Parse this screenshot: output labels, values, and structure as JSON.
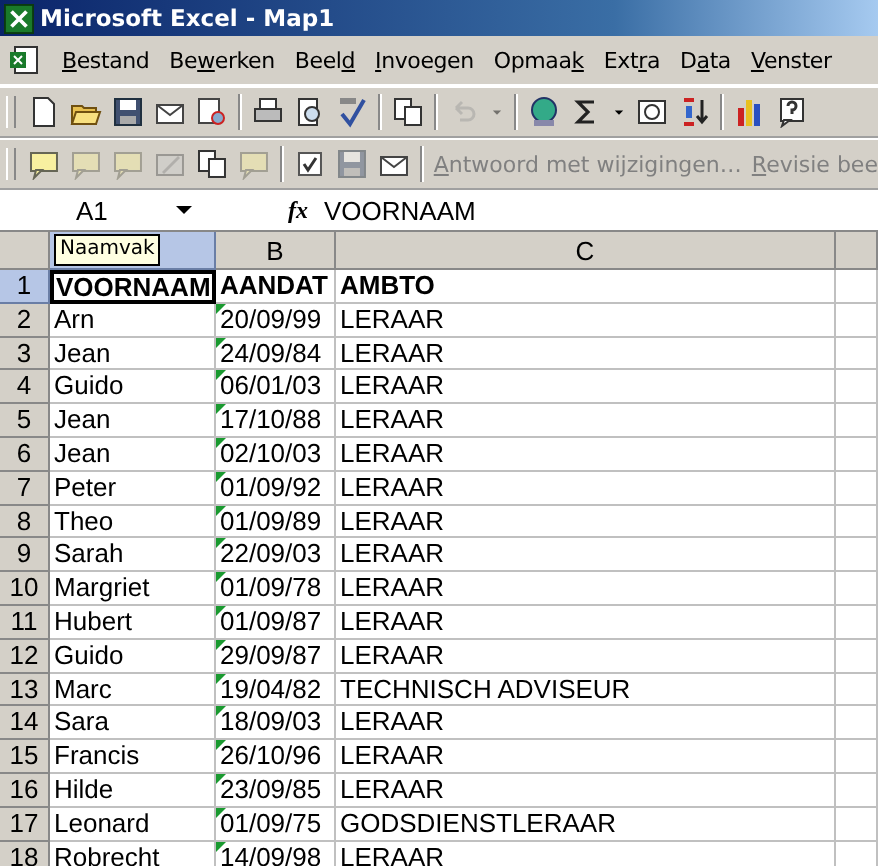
{
  "window": {
    "title": "Microsoft Excel - Map1"
  },
  "menu": [
    {
      "key": "B",
      "post": "estand"
    },
    {
      "pre": "Be",
      "key": "w",
      "post": "erken"
    },
    {
      "pre": "Beel",
      "key": "d"
    },
    {
      "key": "I",
      "post": "nvoegen"
    },
    {
      "pre": "Opmaa",
      "key": "k"
    },
    {
      "pre": "Ext",
      "key": "r",
      "post": "a"
    },
    {
      "pre": "D",
      "key": "a",
      "post": "ta"
    },
    {
      "key": "V",
      "post": "enster"
    }
  ],
  "toolbars": [
    {
      "items": [
        {
          "kind": "new",
          "disabled": false
        },
        {
          "kind": "open",
          "disabled": false
        },
        {
          "kind": "save",
          "disabled": false
        },
        {
          "kind": "mail",
          "disabled": false
        },
        {
          "kind": "web",
          "disabled": false
        },
        {
          "kind": "separator",
          "disabled": false
        },
        {
          "kind": "print",
          "disabled": false
        },
        {
          "kind": "preview",
          "disabled": false
        },
        {
          "kind": "spelling",
          "disabled": false
        },
        {
          "kind": "separator",
          "disabled": false
        },
        {
          "kind": "copy",
          "disabled": false
        },
        {
          "kind": "separator",
          "disabled": false
        },
        {
          "kind": "undo",
          "disabled": true
        },
        {
          "kind": "dropdown",
          "disabled": true
        },
        {
          "kind": "separator",
          "disabled": false
        },
        {
          "kind": "globe",
          "disabled": false
        },
        {
          "kind": "sum",
          "disabled": false
        },
        {
          "kind": "dropdown",
          "disabled": false
        },
        {
          "kind": "currency",
          "disabled": false
        },
        {
          "kind": "sort",
          "disabled": false
        },
        {
          "kind": "separator",
          "disabled": false
        },
        {
          "kind": "chart",
          "disabled": false
        },
        {
          "kind": "help",
          "disabled": false
        }
      ]
    },
    {
      "items": [
        {
          "kind": "comment",
          "disabled": false
        },
        {
          "kind": "comment",
          "disabled": true
        },
        {
          "kind": "comment",
          "disabled": true
        },
        {
          "kind": "edit",
          "disabled": true
        },
        {
          "kind": "copy",
          "disabled": false
        },
        {
          "kind": "comment",
          "disabled": true
        },
        {
          "kind": "separator",
          "disabled": false
        },
        {
          "kind": "check",
          "disabled": false
        },
        {
          "kind": "save",
          "disabled": true
        },
        {
          "kind": "mail",
          "disabled": false
        },
        {
          "kind": "separator",
          "disabled": false
        },
        {
          "kind": "text",
          "key": "A",
          "post": "ntwoord met wijzigingen…",
          "disabled": true
        },
        {
          "kind": "text",
          "key": "R",
          "post": "evisie bee",
          "disabled": true
        }
      ]
    }
  ],
  "formula_bar": {
    "name_box": "A1",
    "fx": "fx",
    "value": "VOORNAAM"
  },
  "tooltip": "Naamvak",
  "columns": [
    {
      "selected": true
    },
    {
      "label": "B",
      "selected": false
    },
    {
      "label": "C",
      "selected": false
    }
  ],
  "rows": [
    {
      "number": "1",
      "selected": true,
      "bold": true,
      "flagged": false,
      "cells": [
        "VOORNAAM",
        "AANDAT",
        "AMBTO"
      ]
    },
    {
      "number": "2",
      "selected": false,
      "bold": false,
      "flagged": true,
      "cells": [
        "Arn",
        "20/09/99",
        "LERAAR"
      ]
    },
    {
      "number": "3",
      "selected": false,
      "bold": false,
      "flagged": true,
      "cells": [
        "Jean",
        "24/09/84",
        "LERAAR"
      ]
    },
    {
      "number": "4",
      "selected": false,
      "bold": false,
      "flagged": true,
      "cells": [
        "Guido",
        "06/01/03",
        "LERAAR"
      ]
    },
    {
      "number": "5",
      "selected": false,
      "bold": false,
      "flagged": true,
      "cells": [
        "Jean",
        "17/10/88",
        "LERAAR"
      ]
    },
    {
      "number": "6",
      "selected": false,
      "bold": false,
      "flagged": true,
      "cells": [
        "Jean",
        "02/10/03",
        "LERAAR"
      ]
    },
    {
      "number": "7",
      "selected": false,
      "bold": false,
      "flagged": true,
      "cells": [
        "Peter",
        "01/09/92",
        "LERAAR"
      ]
    },
    {
      "number": "8",
      "selected": false,
      "bold": false,
      "flagged": true,
      "cells": [
        "Theo",
        "01/09/89",
        "LERAAR"
      ]
    },
    {
      "number": "9",
      "selected": false,
      "bold": false,
      "flagged": true,
      "cells": [
        "Sarah",
        "22/09/03",
        "LERAAR"
      ]
    },
    {
      "number": "10",
      "selected": false,
      "bold": false,
      "flagged": true,
      "cells": [
        "Margriet",
        "01/09/78",
        "LERAAR"
      ]
    },
    {
      "number": "11",
      "selected": false,
      "bold": false,
      "flagged": true,
      "cells": [
        "Hubert",
        "01/09/87",
        "LERAAR"
      ]
    },
    {
      "number": "12",
      "selected": false,
      "bold": false,
      "flagged": true,
      "cells": [
        "Guido",
        "29/09/87",
        "LERAAR"
      ]
    },
    {
      "number": "13",
      "selected": false,
      "bold": false,
      "flagged": true,
      "cells": [
        "Marc",
        "19/04/82",
        "TECHNISCH ADVISEUR"
      ]
    },
    {
      "number": "14",
      "selected": false,
      "bold": false,
      "flagged": true,
      "cells": [
        "Sara",
        "18/09/03",
        "LERAAR"
      ]
    },
    {
      "number": "15",
      "selected": false,
      "bold": false,
      "flagged": true,
      "cells": [
        "Francis",
        "26/10/96",
        "LERAAR"
      ]
    },
    {
      "number": "16",
      "selected": false,
      "bold": false,
      "flagged": true,
      "cells": [
        "Hilde",
        "23/09/85",
        "LERAAR"
      ]
    },
    {
      "number": "17",
      "selected": false,
      "bold": false,
      "flagged": true,
      "cells": [
        "Leonard",
        "01/09/75",
        "GODSDIENSTLERAAR"
      ]
    },
    {
      "number": "18",
      "selected": false,
      "bold": false,
      "flagged": true,
      "cells": [
        "Robrecht",
        "14/09/98",
        "LERAAR"
      ]
    }
  ]
}
